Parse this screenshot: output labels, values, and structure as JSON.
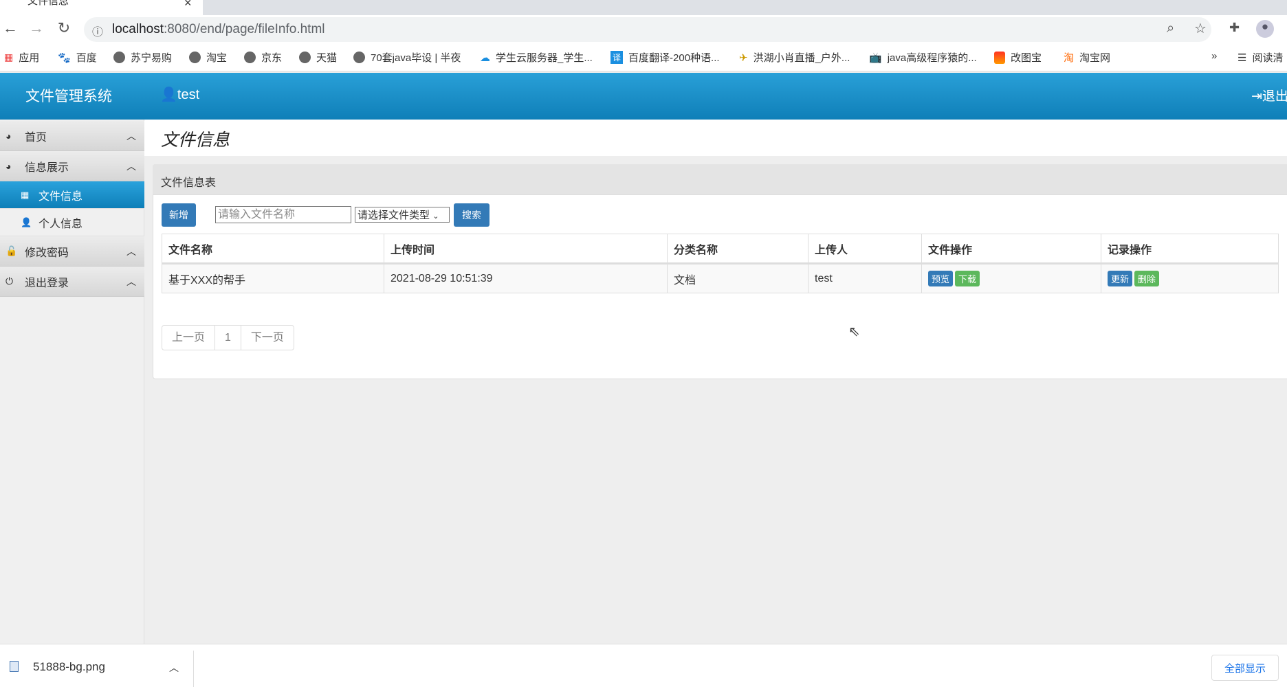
{
  "browser": {
    "tab_title": "文件信息",
    "url_host": "localhost",
    "url_rest": ":8080/end/page/fileInfo.html",
    "bookmarks": [
      "应用",
      "百度",
      "苏宁易购",
      "淘宝",
      "京东",
      "天猫",
      "70套java毕设 | 半夜",
      "学生云服务器_学生...",
      "百度翻译-200种语...",
      "洪湖小肖直播_户外...",
      "java高级程序猿的...",
      "改图宝",
      "淘宝网"
    ],
    "more": "»",
    "reading_list": "阅读清"
  },
  "header": {
    "brand": "文件管理系统",
    "user": "test",
    "logout": "退出"
  },
  "sidebar": {
    "groups": [
      {
        "label": "首页"
      },
      {
        "label": "信息展示"
      },
      {
        "label": "修改密码"
      },
      {
        "label": "退出登录"
      }
    ],
    "items": [
      {
        "label": "文件信息"
      },
      {
        "label": "个人信息"
      }
    ]
  },
  "page": {
    "title": "文件信息",
    "panel_title": "文件信息表",
    "add": "新增",
    "search_placeholder": "请输入文件名称",
    "select_value": "请选择文件类型",
    "search": "搜索"
  },
  "table": {
    "headers": [
      "文件名称",
      "上传时间",
      "分类名称",
      "上传人",
      "文件操作",
      "记录操作"
    ],
    "rows": [
      {
        "name": "基于XXX的帮手",
        "time": "2021-08-29 10:51:39",
        "category": "文档",
        "uploader": "test",
        "preview": "预览",
        "download": "下载",
        "update": "更新",
        "delete": "删除"
      }
    ]
  },
  "pager": {
    "prev": "上一页",
    "page": "1",
    "next": "下一页"
  },
  "downloads": {
    "file": "51888-bg.png",
    "show_all": "全部显示"
  }
}
